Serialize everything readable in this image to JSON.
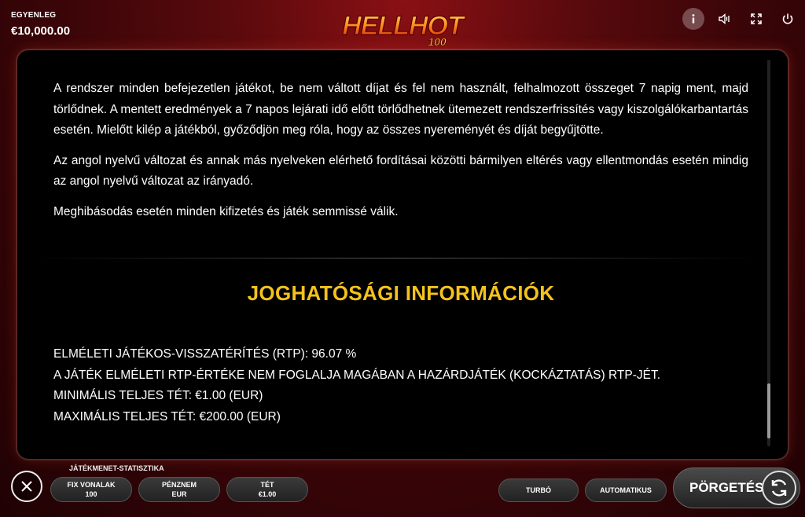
{
  "header": {
    "balance_label": "EGYENLEG",
    "balance_value": "€10,000.00",
    "logo_text": "HELLHOT",
    "logo_sub": "100"
  },
  "toolbar": {
    "info_icon": "info-icon",
    "sound_icon": "sound-icon",
    "fullscreen_icon": "fullscreen-icon",
    "power_icon": "power-icon"
  },
  "rules": {
    "paragraphs": [
      "A rendszer minden befejezetlen játékot, be nem váltott díjat és fel nem használt, felhalmozott összeget 7 napig ment, majd törlődnek. A mentett eredmények a 7 napos lejárati idő előtt törlődhetnek ütemezett rendszerfrissítés vagy kiszolgálókarbantartás esetén. Mielőtt kilép a játékból, győződjön meg róla, hogy az összes nyereményét és díját begyűjtötte.",
      "Az angol nyelvű változat és annak más nyelveken elérhető fordításai közötti bármilyen eltérés vagy ellentmondás esetén mindig az angol nyelvű változat az irányadó.",
      "Meghibásodás esetén minden kifizetés és játék semmissé válik."
    ],
    "section_title": "JOGHATÓSÁGI INFORMÁCIÓK",
    "info_lines": [
      "ELMÉLETI JÁTÉKOS-VISSZATÉRÍTÉS (RTP): 96.07 %",
      "A JÁTÉK ELMÉLETI RTP-ÉRTÉKE NEM FOGLALJA MAGÁBAN A HAZÁRDJÁTÉK (KOCKÁZTATÁS) RTP-JÉT.",
      "MINIMÁLIS TELJES TÉT: €1.00 (EUR)",
      "MAXIMÁLIS TELJES TÉT: €200.00 (EUR)"
    ]
  },
  "bottom": {
    "stats_label": "JÁTÉKMENET-STATISZTIKA",
    "lines_label": "FIX VONALAK",
    "lines_value": "100",
    "currency_label": "PÉNZNEM",
    "currency_value": "EUR",
    "bet_label": "TÉT",
    "bet_value": "€1.00",
    "turbo_label": "TURBÓ",
    "auto_label": "AUTOMATIKUS",
    "spin_label": "PÖRGETÉS"
  },
  "colors": {
    "accent_gold": "#f4c21c",
    "background_red": "#5a0a0d"
  }
}
